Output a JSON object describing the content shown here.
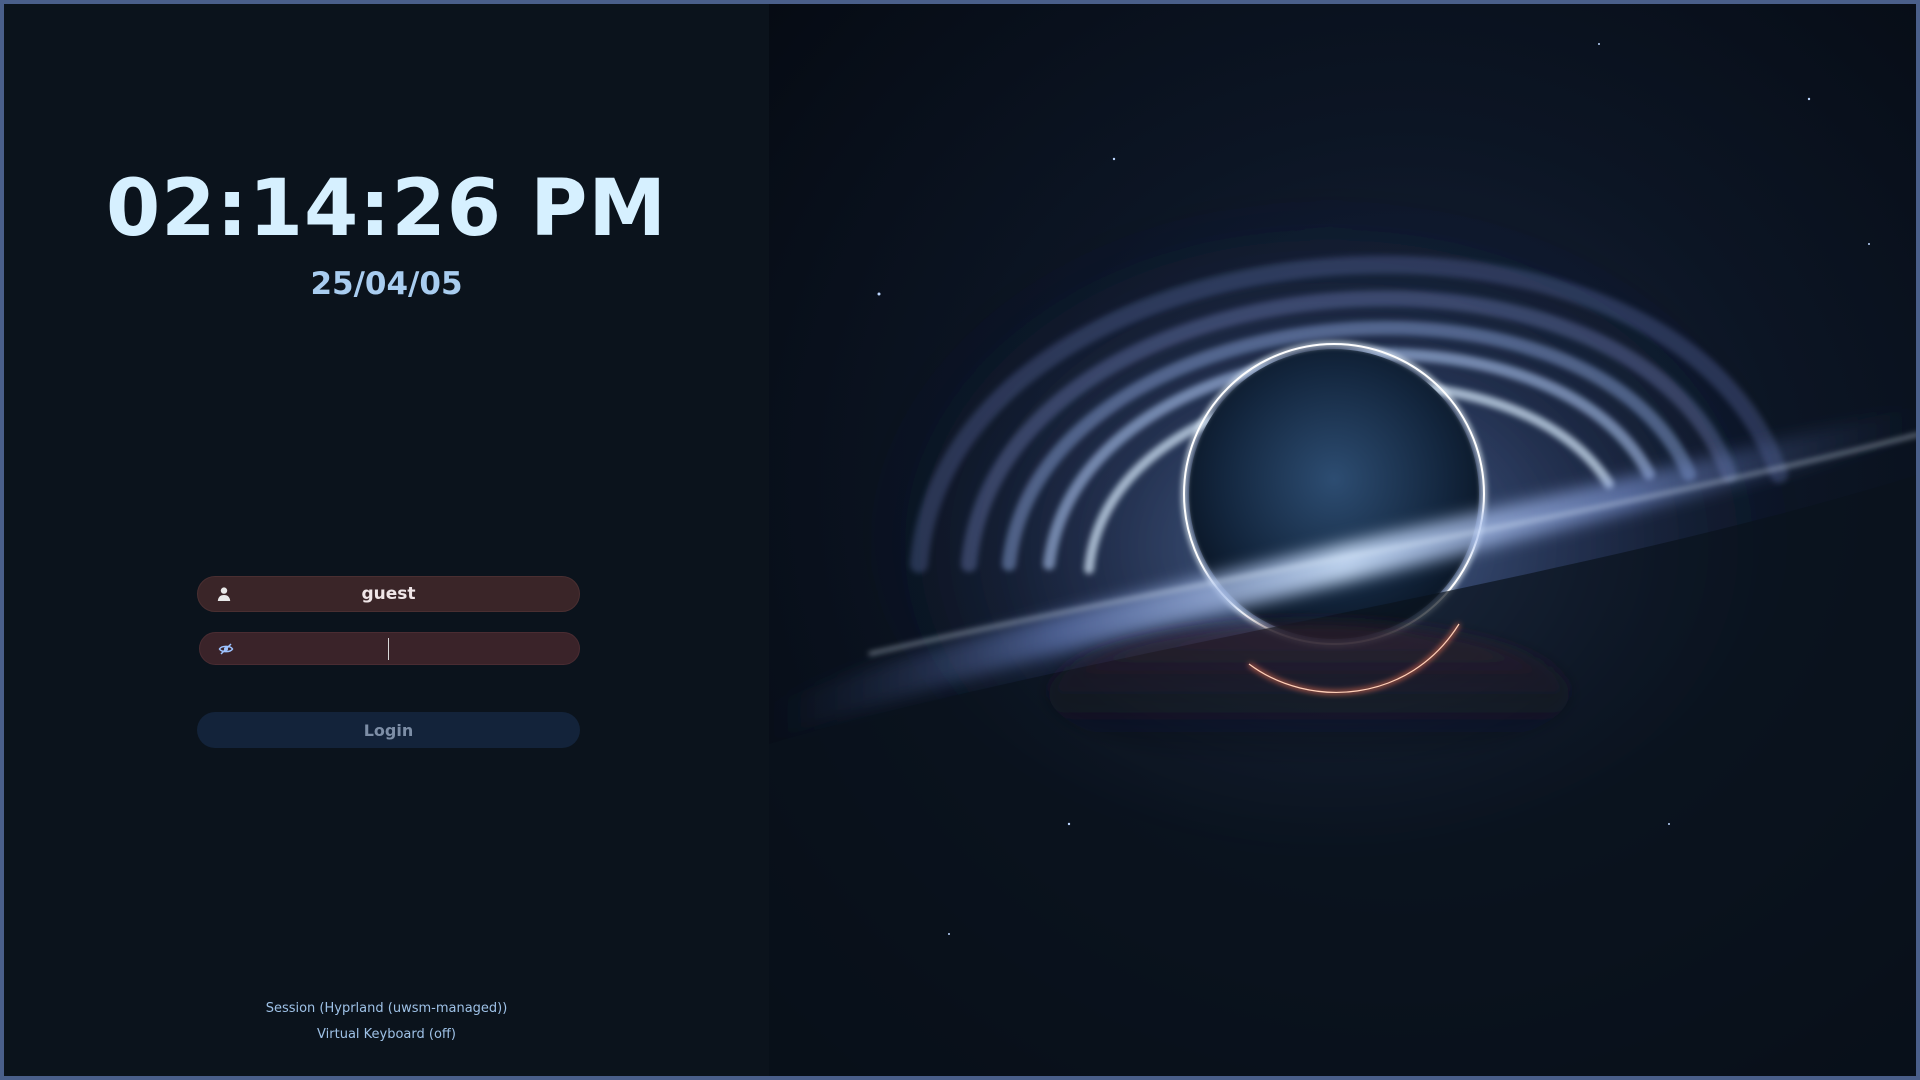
{
  "clock": {
    "time": "02:14:26 PM",
    "date": "25/04/05"
  },
  "login_form": {
    "username_value": "guest",
    "password_value": "",
    "login_label": "Login",
    "user_icon": "user-icon",
    "password_icon": "eye-slash-icon"
  },
  "footer": {
    "session": "Session (Hyprland (uwsm-managed))",
    "virtual_keyboard": "Virtual Keyboard (off)"
  },
  "colors": {
    "accent_text": "#d6f0ff",
    "field_background": "#3a2528",
    "button_background": "#13233a",
    "frame_border": "#4a5f8a"
  }
}
